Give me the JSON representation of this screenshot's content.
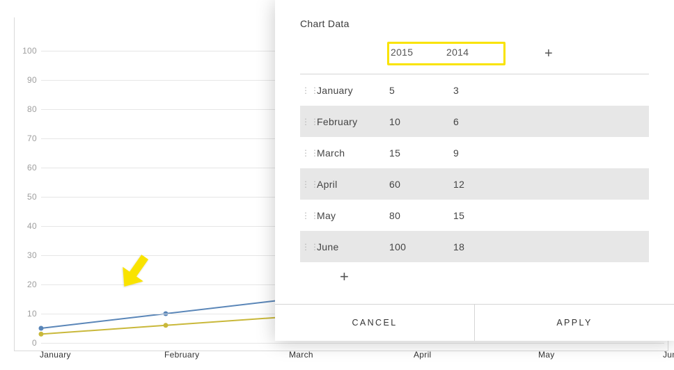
{
  "panel": {
    "title": "Chart Data",
    "series_headers": [
      "2015",
      "2014"
    ],
    "rows": [
      {
        "month": "January",
        "a": "5",
        "b": "3"
      },
      {
        "month": "February",
        "a": "10",
        "b": "6"
      },
      {
        "month": "March",
        "a": "15",
        "b": "9"
      },
      {
        "month": "April",
        "a": "60",
        "b": "12"
      },
      {
        "month": "May",
        "a": "80",
        "b": "15"
      },
      {
        "month": "June",
        "a": "100",
        "b": "18"
      }
    ],
    "add_col_glyph": "+",
    "add_row_glyph": "+",
    "cancel_label": "CANCEL",
    "apply_label": "APPLY"
  },
  "chart_axes": {
    "y_ticks": [
      "100",
      "90",
      "80",
      "70",
      "60",
      "50",
      "40",
      "30",
      "20",
      "10",
      "0"
    ],
    "x_ticks": [
      "January",
      "February",
      "March",
      "April",
      "May",
      "June"
    ]
  },
  "chart_data": {
    "type": "line",
    "title": "",
    "xlabel": "",
    "ylabel": "",
    "ylim": [
      0,
      100
    ],
    "categories": [
      "January",
      "February",
      "March",
      "April",
      "May",
      "June"
    ],
    "series": [
      {
        "name": "2015",
        "values": [
          5,
          10,
          15,
          60,
          80,
          100
        ]
      },
      {
        "name": "2014",
        "values": [
          3,
          6,
          9,
          12,
          15,
          18
        ]
      }
    ],
    "annotations": [
      "yellow arrow pointing to early 2015 segment"
    ]
  }
}
